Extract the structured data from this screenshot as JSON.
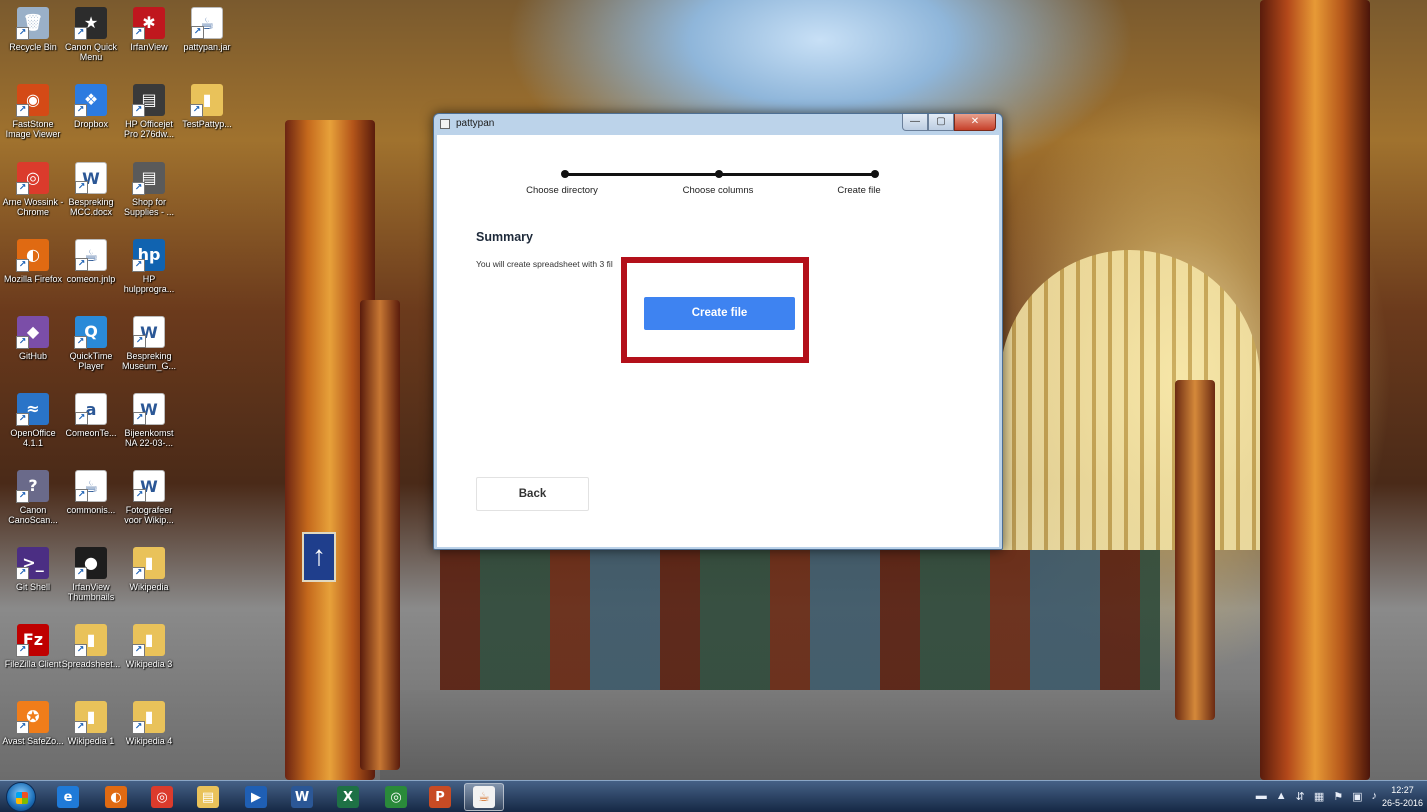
{
  "desktop": {
    "icons": [
      {
        "label": "Recycle Bin",
        "glyph": "🗑",
        "icon": "recycle-bin-icon",
        "color": "#9ab0c8"
      },
      {
        "label": "Canon Quick Menu",
        "glyph": "★",
        "icon": "canon-quick-menu-icon",
        "color": "#2c2c2c"
      },
      {
        "label": "IrfanView",
        "glyph": "✱",
        "icon": "irfanview-icon",
        "color": "#c0171e"
      },
      {
        "label": "pattypan.jar",
        "glyph": "☕",
        "icon": "java-file-icon",
        "color": "#ffffff"
      },
      {
        "label": "FastStone Image Viewer",
        "glyph": "◉",
        "icon": "faststone-eye-icon",
        "color": "#d44a16"
      },
      {
        "label": "Dropbox",
        "glyph": "❖",
        "icon": "dropbox-icon",
        "color": "#2c7be0"
      },
      {
        "label": "HP Officejet Pro 276dw...",
        "glyph": "▤",
        "icon": "printer-icon",
        "color": "#3a3a3a"
      },
      {
        "label": "TestPattyp...",
        "glyph": "▮",
        "icon": "folder-icon",
        "color": "#e9c25a"
      },
      {
        "label": "Arne Wossink - Chrome",
        "glyph": "◎",
        "icon": "chrome-icon",
        "color": "#db3b2c"
      },
      {
        "label": "Bespreking MCC.docx",
        "glyph": "W",
        "icon": "word-document-icon",
        "color": "#ffffff"
      },
      {
        "label": "Shop for Supplies - ...",
        "glyph": "▤",
        "icon": "printer-supplies-icon",
        "color": "#5a5a5a"
      },
      {
        "label": "Mozilla Firefox",
        "glyph": "◐",
        "icon": "firefox-icon",
        "color": "#e06a12"
      },
      {
        "label": "comeon.jnlp",
        "glyph": "☕",
        "icon": "java-file-icon",
        "color": "#ffffff"
      },
      {
        "label": "HP hulpprogra...",
        "glyph": "hp",
        "icon": "hp-icon",
        "color": "#1063b0"
      },
      {
        "label": "GitHub",
        "glyph": "◆",
        "icon": "github-icon",
        "color": "#7b4ea8"
      },
      {
        "label": "QuickTime Player",
        "glyph": "Q",
        "icon": "quicktime-icon",
        "color": "#2a8ad8"
      },
      {
        "label": "Bespreking Museum_G...",
        "glyph": "W",
        "icon": "word-document-icon",
        "color": "#ffffff"
      },
      {
        "label": "OpenOffice 4.1.1",
        "glyph": "≈",
        "icon": "openoffice-icon",
        "color": "#2a74c8"
      },
      {
        "label": "ComeonTe...",
        "glyph": "a",
        "icon": "spreadsheet-file-icon",
        "color": "#ffffff"
      },
      {
        "label": "Bijeenkomst NA 22-03-...",
        "glyph": "W",
        "icon": "word-document-icon",
        "color": "#ffffff"
      },
      {
        "label": "Canon CanoScan...",
        "glyph": "?",
        "icon": "canon-scan-icon",
        "color": "#6a6a8a"
      },
      {
        "label": "commonis...",
        "glyph": "☕",
        "icon": "java-file-icon",
        "color": "#ffffff"
      },
      {
        "label": "Fotografeer voor Wikip...",
        "glyph": "W",
        "icon": "word-document-icon",
        "color": "#ffffff"
      },
      {
        "label": "Git Shell",
        "glyph": ">_",
        "icon": "git-shell-icon",
        "color": "#4b2e83"
      },
      {
        "label": "IrfanView Thumbnails",
        "glyph": "●",
        "icon": "irfanview-thumbnails-icon",
        "color": "#1d1d1d"
      },
      {
        "label": "Wikipedia",
        "glyph": "▮",
        "icon": "folder-icon",
        "color": "#e9c25a"
      },
      {
        "label": "FileZilla Client",
        "glyph": "Fz",
        "icon": "filezilla-icon",
        "color": "#bf0000"
      },
      {
        "label": "Spreadsheet...",
        "glyph": "▮",
        "icon": "folder-icon",
        "color": "#e9c25a"
      },
      {
        "label": "Wikipedia 3",
        "glyph": "▮",
        "icon": "folder-icon",
        "color": "#e9c25a"
      },
      {
        "label": "Avast SafeZo...",
        "glyph": "✪",
        "icon": "avast-icon",
        "color": "#f07d1a"
      },
      {
        "label": "Wikipedia 1",
        "glyph": "▮",
        "icon": "folder-icon",
        "color": "#e9c25a"
      },
      {
        "label": "Wikipedia 4",
        "glyph": "▮",
        "icon": "folder-icon",
        "color": "#e9c25a"
      }
    ]
  },
  "window": {
    "title": "pattypan",
    "minimize_glyph": "—",
    "maximize_glyph": "▢",
    "close_glyph": "✕",
    "steps": [
      {
        "label": "Choose directory"
      },
      {
        "label": "Choose columns"
      },
      {
        "label": "Create file"
      }
    ],
    "summary_title": "Summary",
    "summary_text": "You will create spreadsheet with 3 fil",
    "create_button": "Create file",
    "back_button": "Back"
  },
  "annotation": {
    "color": "#b3101a"
  },
  "taskbar": {
    "items": [
      {
        "name": "internet-explorer-icon",
        "glyph": "e",
        "color": "#1f7ad8",
        "active": false
      },
      {
        "name": "firefox-icon",
        "glyph": "◐",
        "color": "#e06a12",
        "active": false
      },
      {
        "name": "chrome-icon",
        "glyph": "◎",
        "color": "#db3b2c",
        "active": false
      },
      {
        "name": "file-explorer-icon",
        "glyph": "▤",
        "color": "#e9c25a",
        "active": false
      },
      {
        "name": "media-player-icon",
        "glyph": "▶",
        "color": "#1f5fb4",
        "active": false
      },
      {
        "name": "word-icon",
        "glyph": "W",
        "color": "#2b5796",
        "active": false
      },
      {
        "name": "excel-icon",
        "glyph": "X",
        "color": "#1e7145",
        "active": false
      },
      {
        "name": "chrome-alt-icon",
        "glyph": "◎",
        "color": "#2a8a3a",
        "active": false
      },
      {
        "name": "powerpoint-icon",
        "glyph": "P",
        "color": "#c84b24",
        "active": false
      },
      {
        "name": "java-icon",
        "glyph": "☕",
        "color": "#f2f2f2",
        "active": true
      }
    ],
    "tray_icons": [
      "▬",
      "▲",
      "⇵",
      "▦",
      "⚑",
      "▣",
      "♪"
    ],
    "time": "12:27",
    "date": "26-5-2016"
  }
}
